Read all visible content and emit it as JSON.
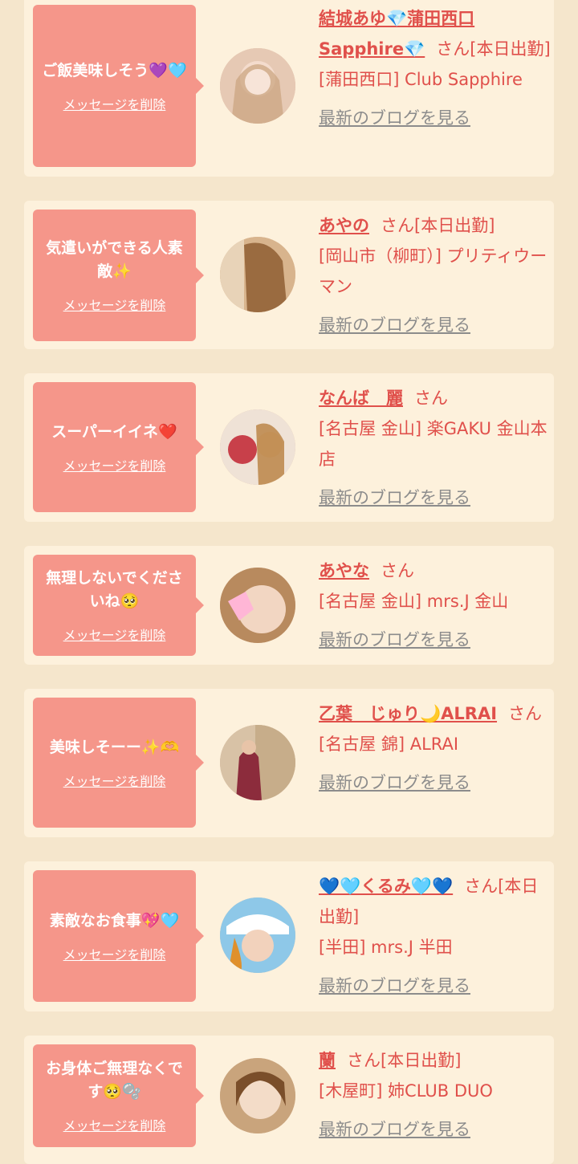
{
  "delete_label": "メッセージを削除",
  "blog_label": "最新のブログを見る",
  "items": [
    {
      "message": "ご飯美味しそう",
      "message_emoji": "💜🩵",
      "name": "結城あゆ💎蒲田西口Sapphire💎",
      "suffix": "さん[本日出勤]",
      "shop": "[蒲田西口] Club Sapphire"
    },
    {
      "message": "気遣いができる人素敵",
      "message_emoji": "✨",
      "name": "あやの",
      "suffix": "さん[本日出勤]",
      "shop": "[岡山市（柳町）] プリティウーマン"
    },
    {
      "message": "スーパーイイネ",
      "message_emoji": "❤️",
      "name": "なんば　麗",
      "suffix": "さん",
      "shop": "[名古屋 金山] 楽GAKU 金山本店"
    },
    {
      "message": "無理しないでくださいね",
      "message_emoji": "🥺",
      "name": "あやな",
      "suffix": "さん",
      "shop": "[名古屋 金山] mrs.J 金山"
    },
    {
      "message": "美味しそーー",
      "message_emoji": "✨🫶",
      "name": "乙葉　じゅり🌙ALRAI",
      "suffix": "さん",
      "shop": "[名古屋 錦] ALRAI"
    },
    {
      "message": "素敵なお食事",
      "message_emoji": "💖🩵",
      "name": "💙🩵くるみ🩵💙",
      "suffix": "さん[本日出勤]",
      "shop": "[半田] mrs.J 半田"
    },
    {
      "message": "お身体ご無理なくです",
      "message_emoji": "🥺🫧",
      "name": "蘭",
      "suffix": "さん[本日出勤]",
      "shop": "[木屋町] 姉CLUB DUO"
    }
  ],
  "colors": {
    "background": "#f5e6cc",
    "card": "#fdf1dc",
    "bubble": "#f5968a",
    "name": "#e0504b",
    "link_gray": "#8c8c8c"
  }
}
